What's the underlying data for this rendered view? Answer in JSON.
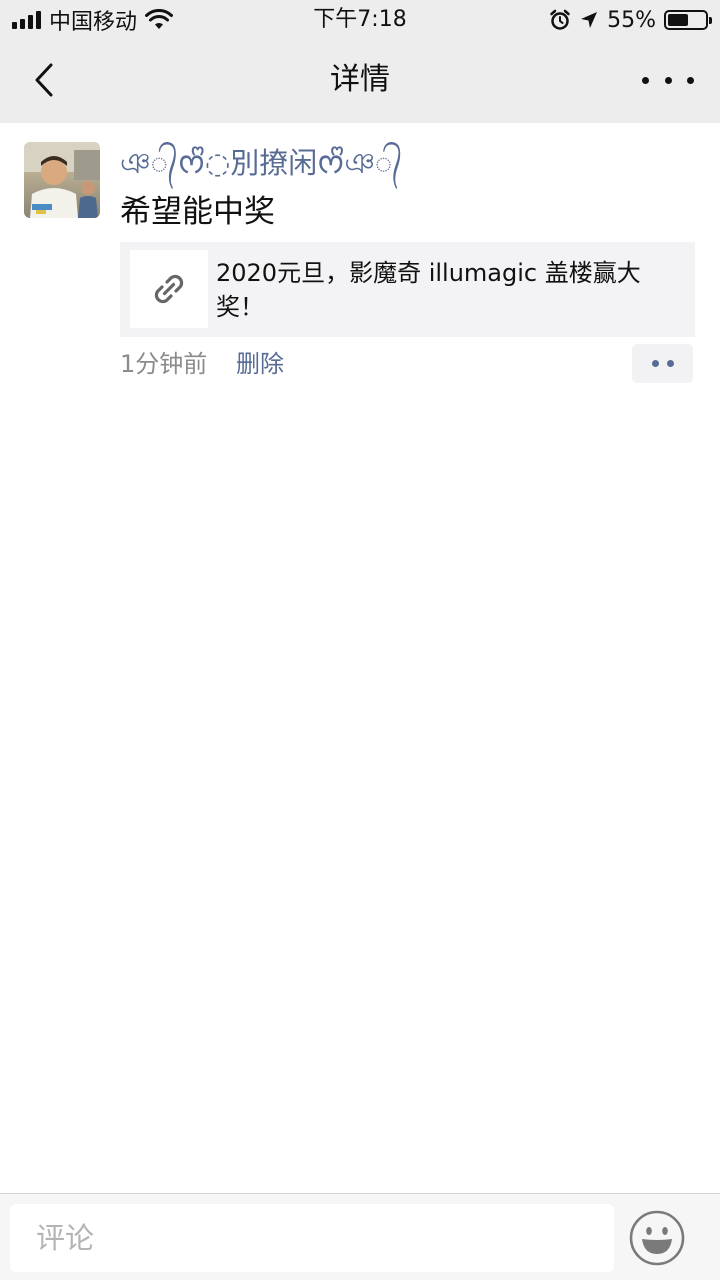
{
  "status_bar": {
    "carrier": "中国移动",
    "time": "下午7:18",
    "battery_percent": "55%",
    "battery_level": 0.55,
    "icons": [
      "signal-icon",
      "wifi-icon",
      "alarm-icon",
      "location-icon",
      "battery-icon"
    ]
  },
  "nav": {
    "title": "详情",
    "back_icon": "chevron-left-icon",
    "more_icon": "more-dots-icon"
  },
  "post": {
    "author": "ঞ᭄ᰔᩚ◌別撩闲ᰔᩚঞ᭄",
    "text": "希望能中奖",
    "link": {
      "title": "2020元旦，影魔奇 illumagic 盖楼赢大奖！",
      "icon": "link-icon"
    },
    "time": "1分钟前",
    "delete_label": "删除",
    "action_icon": "comment-action-icon"
  },
  "comment_bar": {
    "placeholder": "评论",
    "emoji_icon": "emoji-icon"
  },
  "colors": {
    "link_blue": "#576b95",
    "bar_bg": "#ededed",
    "card_bg": "#f3f3f5"
  }
}
